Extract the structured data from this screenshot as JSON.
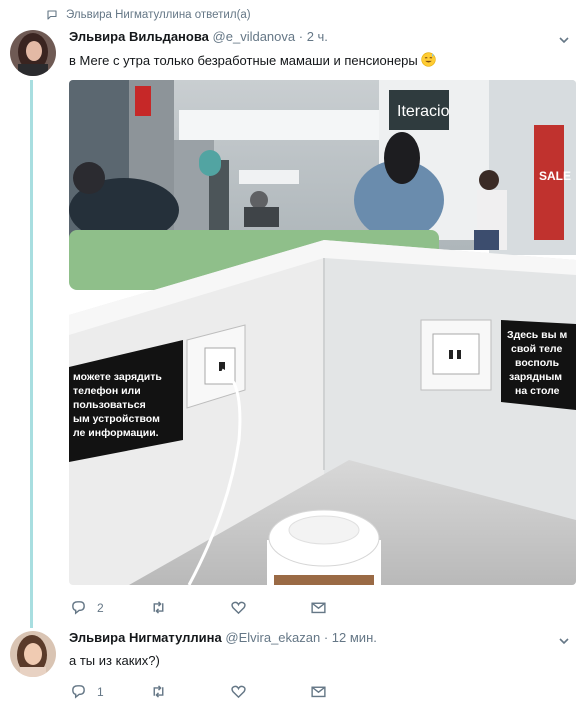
{
  "reply_context": {
    "text": "Эльвира Нигматуллина ответил(а)"
  },
  "tweet1": {
    "name": "Эльвира Вильданова",
    "handle": "@e_vildanova",
    "time": "· 2 ч.",
    "text": "в Меге с утра только безработные мамаши и пенсионеры",
    "emoji": "sweat-smile-emoji",
    "replies": "2",
    "retweets": "",
    "likes": "",
    "photo": {
      "store_sign": "Iteracio",
      "sale_sign": "SALE",
      "sign_left": "можете зарядить\nтелефон или\nпользоваться\nым устройством\nле информации.",
      "sign_right": "Здесь вы м\nсвой теле\nвосполь\nзарядным\nна столе"
    }
  },
  "tweet2": {
    "name": "Эльвира Нигматуллина",
    "handle": "@Elvira_ekazan",
    "time": "· 12 мин.",
    "text": "а ты из каких?)",
    "replies": "1",
    "retweets": "",
    "likes": ""
  },
  "colors": {
    "thread_line": "#a8dee0",
    "meta_gray": "#657786",
    "text": "#14171a"
  }
}
